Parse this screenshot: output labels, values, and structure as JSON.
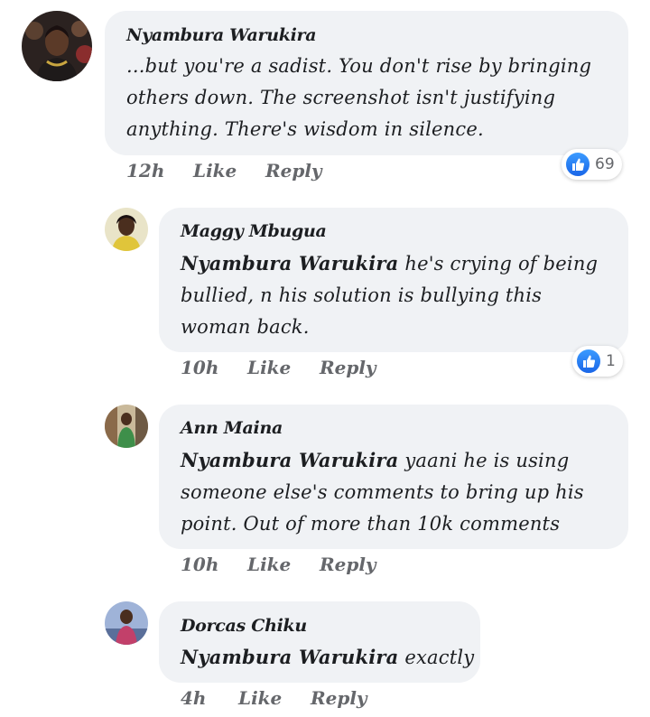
{
  "comments": [
    {
      "author": "Nyambura Warukira",
      "mention": "",
      "text": "...but you're a sadist. You don't rise by bringing others down. The screenshot isn't justifying anything. There's wisdom in silence.",
      "time": "12h",
      "like_label": "Like",
      "reply_label": "Reply",
      "reaction_count": "69",
      "reaction_icon": "like-icon",
      "avatar_color": "#3a2a22"
    },
    {
      "author": "Maggy Mbugua",
      "mention": "Nyambura Warukira",
      "text": " he's crying of being bullied, n his solution is bullying this woman back.",
      "time": "10h",
      "like_label": "Like",
      "reply_label": "Reply",
      "reaction_count": "1",
      "reaction_icon": "like-icon",
      "avatar_color": "#d9c46a"
    },
    {
      "author": "Ann Maina",
      "mention": "Nyambura Warukira",
      "text": " yaani he is using someone else's comments to bring up his point. Out of more than 10k comments",
      "time": "10h",
      "like_label": "Like",
      "reply_label": "Reply",
      "avatar_color": "#8a6a4a"
    },
    {
      "author": "Dorcas Chiku",
      "mention": "Nyambura Warukira",
      "text": " exactly",
      "time": "4h",
      "like_label": "Like",
      "reply_label": "Reply",
      "avatar_color": "#6b7fb0"
    }
  ],
  "colors": {
    "bubble": "#f0f2f5",
    "secondary_text": "#65676b",
    "like_blue": "#1877f2"
  }
}
